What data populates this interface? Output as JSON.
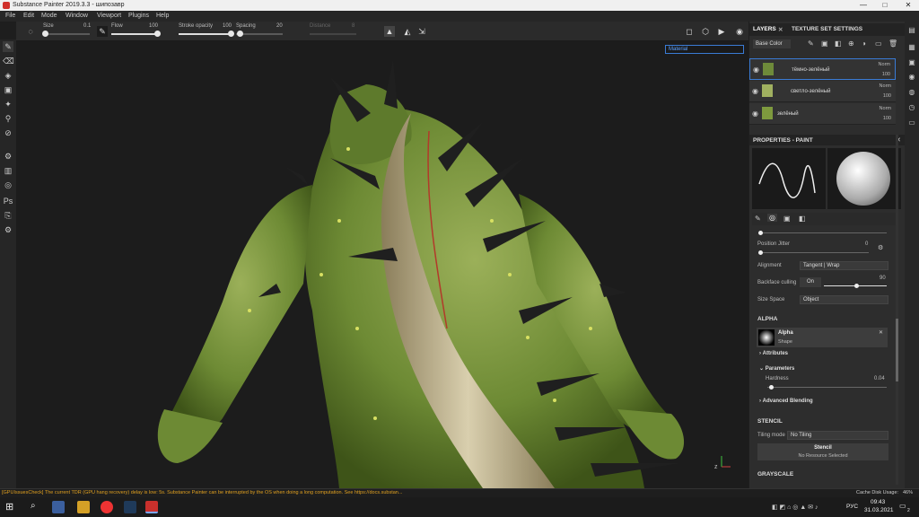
{
  "window": {
    "title": "Substance Painter 2019.3.3 - шипозавр",
    "min": "—",
    "max": "□",
    "close": "✕"
  },
  "menu": [
    "File",
    "Edit",
    "Mode",
    "Window",
    "Viewport",
    "Plugins",
    "Help"
  ],
  "tool_options": {
    "size_label": "Size",
    "size_value": "0.1",
    "flow_label": "Flow",
    "flow_value": "100",
    "stroke_opacity_label": "Stroke opacity",
    "stroke_opacity_value": "100",
    "spacing_label": "Spacing",
    "spacing_value": "20",
    "distance_label": "Distance",
    "distance_value": "8"
  },
  "viewport": {
    "material_mode": "Material"
  },
  "layers_panel": {
    "tab_layers": "LAYERS",
    "tab_texture_set": "TEXTURE SET SETTINGS",
    "channel": "Base Color",
    "layers": [
      {
        "name": "тёмно-зелёный",
        "blend": "Norm",
        "opacity": "100"
      },
      {
        "name": "светло-зелёный",
        "blend": "Norm",
        "opacity": "100"
      },
      {
        "name": "зелёный",
        "blend": "Norm",
        "opacity": "100"
      }
    ]
  },
  "properties": {
    "header": "PROPERTIES - PAINT",
    "position_jitter_label": "Position Jitter",
    "position_jitter_value": "0",
    "alignment_label": "Alignment",
    "alignment_value": "Tangent | Wrap",
    "backface_label": "Backface culling",
    "backface_value": "On",
    "backface_num": "90",
    "size_space_label": "Size Space",
    "size_space_value": "Object",
    "alpha_section": "ALPHA",
    "alpha_name": "Alpha",
    "alpha_sub": "Shape",
    "attributes": "Attributes",
    "parameters": "Parameters",
    "hardness_label": "Hardness",
    "hardness_value": "0.04",
    "advanced_blending": "Advanced Blending",
    "stencil_section": "STENCIL",
    "tiling_label": "Tiling mode",
    "tiling_value": "No Tiling",
    "stencil_btn": "Stencil",
    "stencil_sub": "No Resource Selected",
    "grayscale_section": "GRAYSCALE"
  },
  "status": {
    "message": "[GPUIssuesCheck] The current TDR (GPU hang recovery) delay is low: 5s. Substance Painter can be interrupted by the OS when doing a long computation. See https://docs.substan...",
    "cache": "Cache Disk Usage:",
    "cache_value": "46%"
  },
  "taskbar": {
    "lang": "РУС",
    "time": "09:43",
    "date": "31.03.2021",
    "notif": "2"
  }
}
